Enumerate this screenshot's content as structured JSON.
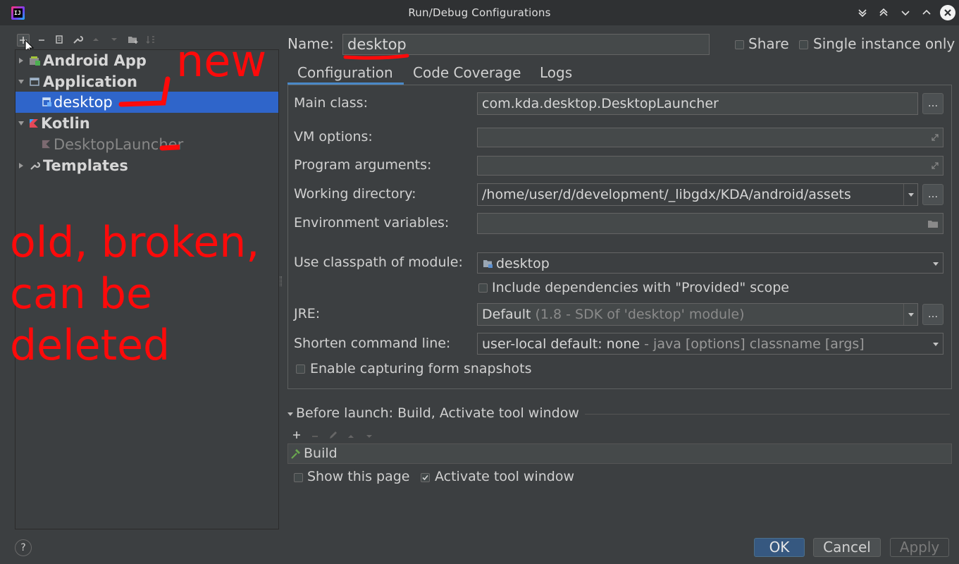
{
  "window": {
    "title": "Run/Debug Configurations",
    "app_icon_letters": "IJ"
  },
  "toolbar": {
    "icons": [
      "plus-icon",
      "minus-icon",
      "copy-icon",
      "wrench-icon",
      "arrow-up-icon",
      "arrow-down-icon",
      "folder-icon",
      "sort-icon"
    ]
  },
  "tree": {
    "items": [
      {
        "label": "Android App",
        "expanded": false,
        "style": "bold"
      },
      {
        "label": "Application",
        "expanded": true,
        "style": "bold"
      },
      {
        "label": "desktop",
        "selected": true
      },
      {
        "label": "Kotlin",
        "expanded": true,
        "style": "bold"
      },
      {
        "label": "DesktopLauncher",
        "style": "dim"
      },
      {
        "label": "Templates",
        "expanded": false,
        "style": "bold"
      }
    ]
  },
  "annotations": {
    "new": "new",
    "old_line1": "old, broken,",
    "old_line2": "can be",
    "old_line3": "deleted"
  },
  "header": {
    "name_label": "Name:",
    "name_value": "desktop",
    "share_label": "Share",
    "single_instance_label": "Single instance only"
  },
  "tabs": [
    "Configuration",
    "Code Coverage",
    "Logs"
  ],
  "form": {
    "main_class_label": "Main class:",
    "main_class_value": "com.kda.desktop.DesktopLauncher",
    "vm_options_label": "VM options:",
    "program_args_label": "Program arguments:",
    "working_dir_label": "Working directory:",
    "working_dir_value": "/home/user/d/development/_libgdx/KDA/android/assets",
    "env_vars_label": "Environment variables:",
    "classpath_label": "Use classpath of module:",
    "classpath_value": "desktop",
    "include_deps_label": "Include dependencies with \"Provided\" scope",
    "jre_label": "JRE:",
    "jre_value": "Default",
    "jre_hint": "(1.8 - SDK of 'desktop' module)",
    "shorten_label": "Shorten command line:",
    "shorten_value": "user-local default: none",
    "shorten_hint": "- java [options] classname [args]",
    "capture_label": "Enable capturing form snapshots",
    "dots": "..."
  },
  "before_launch": {
    "title": "Before launch: Build, Activate tool window",
    "task": "Build",
    "show_page_label": "Show this page",
    "activate_label": "Activate tool window",
    "activate_checked": true
  },
  "footer": {
    "help": "?",
    "ok": "OK",
    "cancel": "Cancel",
    "apply": "Apply"
  },
  "colors": {
    "selection": "#2f65ca",
    "annotation": "#ff0a0a",
    "accent": "#4a88c7"
  }
}
